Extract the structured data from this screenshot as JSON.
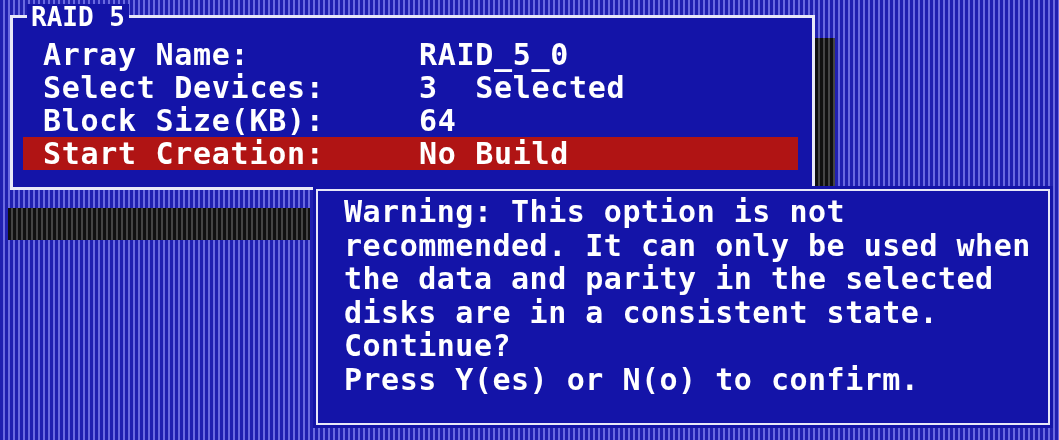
{
  "dialog": {
    "title": "RAID 5",
    "fields": [
      {
        "label": "Array Name:",
        "value": "RAID_5_0",
        "selected": false
      },
      {
        "label": "Select Devices:",
        "value": "3  Selected",
        "selected": false
      },
      {
        "label": "Block Size(KB):",
        "value": "64",
        "selected": false
      },
      {
        "label": "Start Creation:",
        "value": "No Build",
        "selected": true
      }
    ]
  },
  "warning": {
    "lines": [
      "Warning: This option is not",
      "recommended. It can only be used when",
      "the data and parity in the selected",
      "disks are in a consistent state.",
      "Continue?",
      "Press Y(es) or N(o) to confirm."
    ]
  }
}
